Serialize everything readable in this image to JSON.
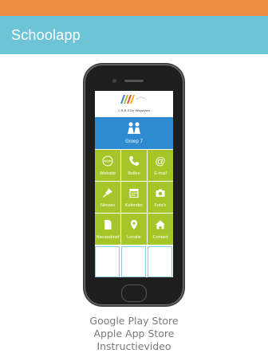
{
  "header": {
    "title": "Schoolapp"
  },
  "phone": {
    "logo_text": "C.B.B.S De Wegwyzer",
    "group_label": "Groep 7",
    "tiles": [
      {
        "label": "Website",
        "icon": "www-icon"
      },
      {
        "label": "Bellen",
        "icon": "phone-icon"
      },
      {
        "label": "E-mail",
        "icon": "at-icon"
      },
      {
        "label": "Nieuws",
        "icon": "pin-icon"
      },
      {
        "label": "Kalender",
        "icon": "calendar-icon"
      },
      {
        "label": "Foto's",
        "icon": "camera-icon"
      },
      {
        "label": "Nieuwsbrief",
        "icon": "document-icon"
      },
      {
        "label": "Locatie",
        "icon": "location-icon"
      },
      {
        "label": "Contact",
        "icon": "home-icon"
      }
    ]
  },
  "links": {
    "google": "Google Play Store",
    "apple": "Apple App Store",
    "video": "Instructievideo"
  },
  "colors": {
    "top_bar": "#F08C43",
    "header": "#6CC4D6",
    "group_tile": "#2E8BCF",
    "tile": "#A5C529"
  }
}
